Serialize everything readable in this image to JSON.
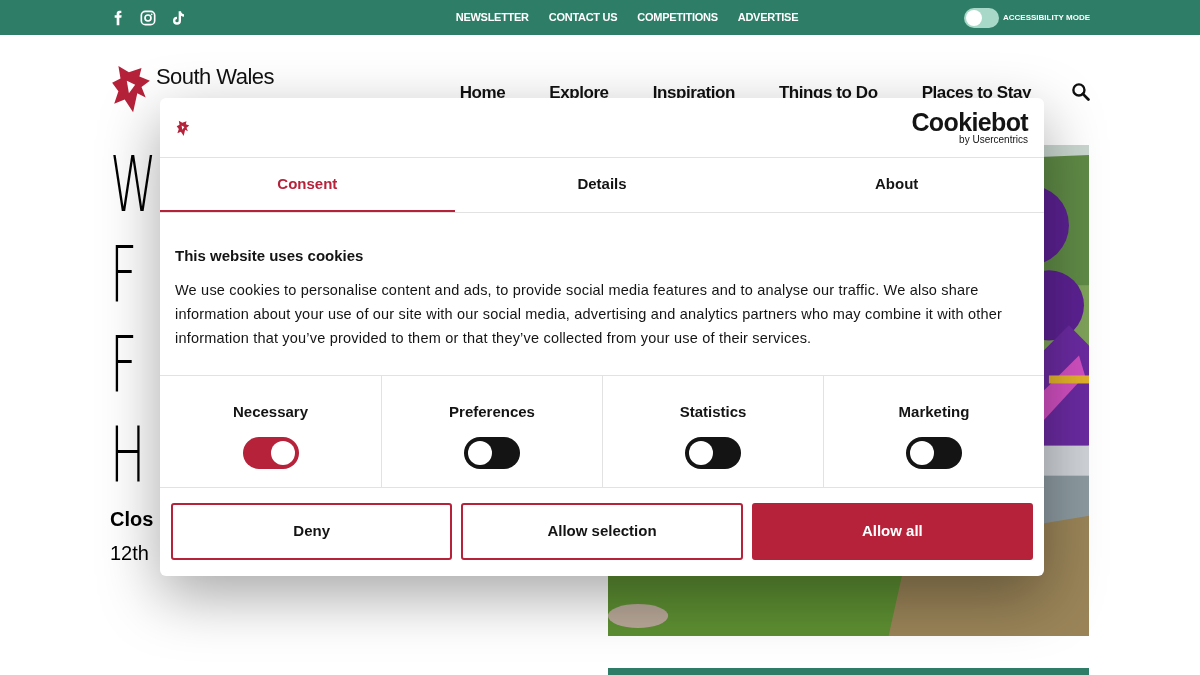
{
  "top_bar": {
    "links": [
      "NEWSLETTER",
      "CONTACT US",
      "COMPETITIONS",
      "ADVERTISE"
    ],
    "accessibility": {
      "label": "ACCESSIBILITY MODE",
      "on": false
    }
  },
  "header": {
    "logo_text": "South Wales",
    "nav": [
      "Home",
      "Explore",
      "Inspiration",
      "Things to Do",
      "Places to Stay"
    ]
  },
  "hero": {
    "heading_lines": [
      "W",
      "F",
      "F",
      "H"
    ],
    "subtitle": "Clos",
    "date": "12th"
  },
  "cookie_dialog": {
    "brand": "Cookiebot",
    "brand_sub": "by Usercentrics",
    "tabs": [
      {
        "label": "Consent",
        "selected": true
      },
      {
        "label": "Details",
        "selected": false
      },
      {
        "label": "About",
        "selected": false
      }
    ],
    "title": "This website uses cookies",
    "body": "We use cookies to personalise content and ads, to provide social media features and to analyse our traffic. We also share information about your use of our site with our social media, advertising and analytics partners who may combine it with other information that you’ve provided to them or that they’ve collected from your use of their services.",
    "categories": [
      {
        "label": "Necessary",
        "checked": true
      },
      {
        "label": "Preferences",
        "checked": false
      },
      {
        "label": "Statistics",
        "checked": false
      },
      {
        "label": "Marketing",
        "checked": false
      }
    ],
    "buttons": [
      {
        "label": "Deny",
        "kind": "outline"
      },
      {
        "label": "Allow selection",
        "kind": "outline"
      },
      {
        "label": "Allow all",
        "kind": "filled"
      }
    ]
  }
}
